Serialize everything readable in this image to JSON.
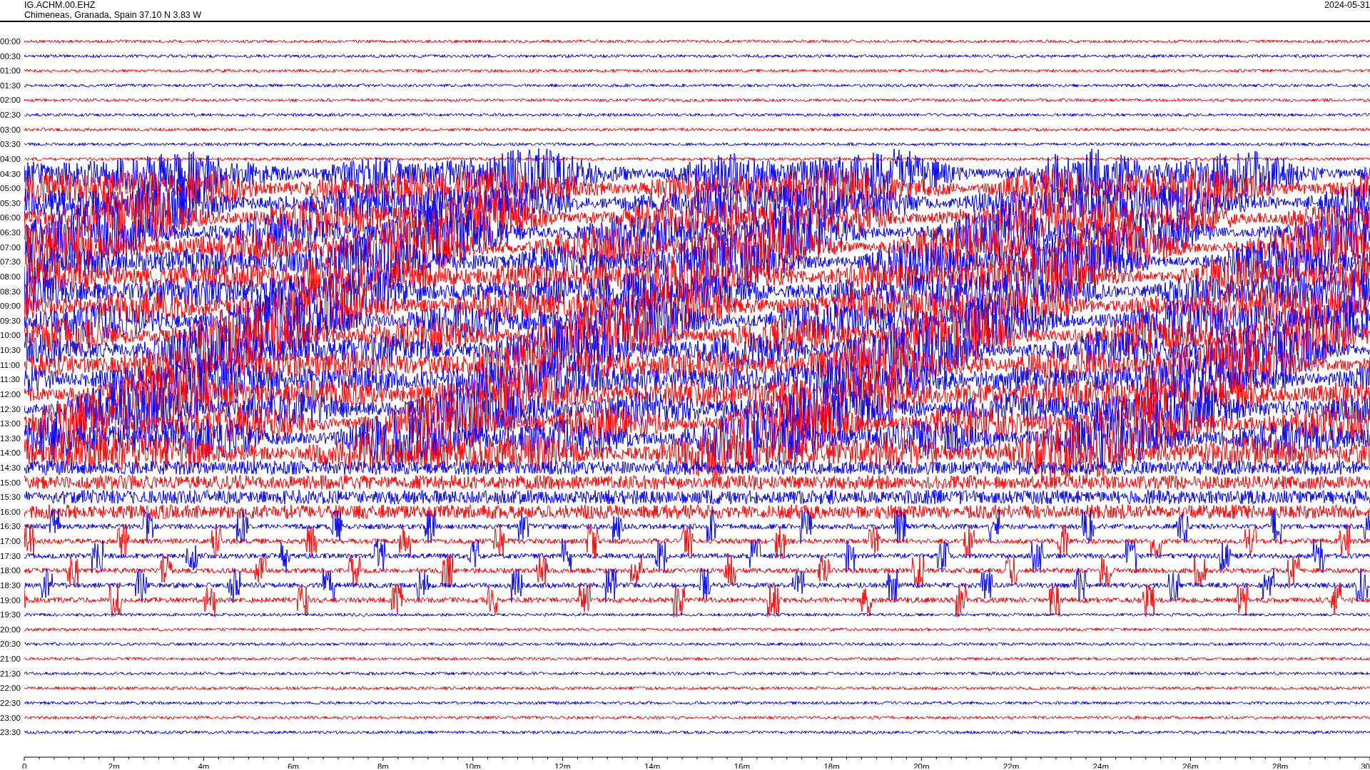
{
  "header": {
    "station": "IG.ACHM.00.EHZ",
    "location": "Chimeneas, Granada, Spain  37.10 N 3.83 W",
    "date": "2024-05-31"
  },
  "rows": [
    {
      "label": "00:00",
      "color": "#ff0000"
    },
    {
      "label": "00:30",
      "color": "#0000ff"
    },
    {
      "label": "01:00",
      "color": "#ff0000"
    },
    {
      "label": "01:30",
      "color": "#0000ff"
    },
    {
      "label": "02:00",
      "color": "#ff0000"
    },
    {
      "label": "02:30",
      "color": "#0000ff"
    },
    {
      "label": "03:00",
      "color": "#ff0000"
    },
    {
      "label": "03:30",
      "color": "#0000ff"
    },
    {
      "label": "04:00",
      "color": "#ff0000"
    },
    {
      "label": "04:30",
      "color": "#0000ff"
    },
    {
      "label": "05:00",
      "color": "#ff0000"
    },
    {
      "label": "05:30",
      "color": "#0000ff"
    },
    {
      "label": "06:00",
      "color": "#ff0000"
    },
    {
      "label": "06:30",
      "color": "#0000ff"
    },
    {
      "label": "07:00",
      "color": "#ff0000"
    },
    {
      "label": "07:30",
      "color": "#0000ff"
    },
    {
      "label": "08:00",
      "color": "#ff0000"
    },
    {
      "label": "08:30",
      "color": "#0000ff"
    },
    {
      "label": "09:00",
      "color": "#ff0000"
    },
    {
      "label": "09:30",
      "color": "#0000ff"
    },
    {
      "label": "10:00",
      "color": "#ff0000"
    },
    {
      "label": "10:30",
      "color": "#0000ff"
    },
    {
      "label": "11:00",
      "color": "#ff0000"
    },
    {
      "label": "11:30",
      "color": "#0000ff"
    },
    {
      "label": "12:00",
      "color": "#ff0000"
    },
    {
      "label": "12:30",
      "color": "#0000ff"
    },
    {
      "label": "13:00",
      "color": "#ff0000"
    },
    {
      "label": "13:30",
      "color": "#0000ff"
    },
    {
      "label": "14:00",
      "color": "#ff0000"
    },
    {
      "label": "14:30",
      "color": "#0000ff"
    },
    {
      "label": "15:00",
      "color": "#ff0000"
    },
    {
      "label": "15:30",
      "color": "#0000ff"
    },
    {
      "label": "16:00",
      "color": "#ff0000"
    },
    {
      "label": "16:30",
      "color": "#0000ff"
    },
    {
      "label": "17:00",
      "color": "#ff0000"
    },
    {
      "label": "17:30",
      "color": "#0000ff"
    },
    {
      "label": "18:00",
      "color": "#ff0000"
    },
    {
      "label": "18:30",
      "color": "#0000ff"
    },
    {
      "label": "19:00",
      "color": "#ff0000"
    },
    {
      "label": "19:30",
      "color": "#0000ff"
    },
    {
      "label": "20:00",
      "color": "#ff0000"
    },
    {
      "label": "20:30",
      "color": "#0000ff"
    },
    {
      "label": "21:00",
      "color": "#ff0000"
    },
    {
      "label": "21:30",
      "color": "#0000ff"
    },
    {
      "label": "22:00",
      "color": "#ff0000"
    },
    {
      "label": "22:30",
      "color": "#0000ff"
    },
    {
      "label": "23:00",
      "color": "#ff0000"
    },
    {
      "label": "23:30",
      "color": "#0000ff"
    }
  ],
  "x_axis": {
    "labels": [
      "0",
      "2m",
      "4m",
      "6m",
      "8m",
      "10m",
      "12m",
      "14m",
      "16m",
      "18m",
      "20m",
      "22m",
      "24m",
      "26m",
      "28m",
      "30"
    ]
  }
}
